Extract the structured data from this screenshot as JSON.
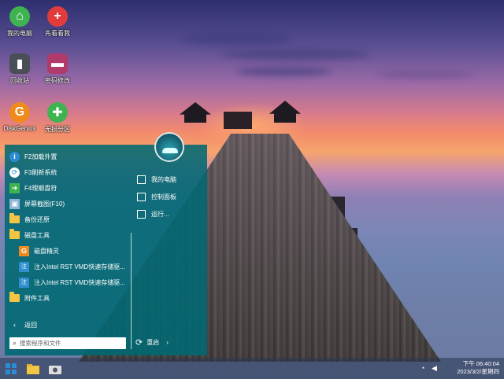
{
  "desktop": {
    "icons": [
      {
        "label": "我的电脑",
        "icon": "computer-icon",
        "color": "#3fb34f"
      },
      {
        "label": "先看看我",
        "icon": "plus-icon",
        "color": "#e23b3b"
      },
      {
        "label": "回收站",
        "icon": "recycle-bin-icon",
        "color": "#5a5f66"
      },
      {
        "label": "密码修改",
        "icon": "password-icon",
        "color": "#b03a6a"
      },
      {
        "label": "DiskGenius",
        "icon": "diskgenius-icon",
        "color": "#f08a1c"
      },
      {
        "label": "无损分区",
        "icon": "partition-icon",
        "color": "#3fb34f"
      }
    ]
  },
  "start_menu": {
    "left_items": [
      {
        "label": "F2加载外置",
        "icon": "info-icon"
      },
      {
        "label": "F3刷新系统",
        "icon": "refresh-icon"
      },
      {
        "label": "F4理顺盘符",
        "icon": "arrow-icon"
      },
      {
        "label": "屏幕截图(F10)",
        "icon": "screenshot-icon"
      },
      {
        "label": "备份还原",
        "icon": "folder-icon"
      },
      {
        "label": "磁盘工具",
        "icon": "folder-icon"
      },
      {
        "label": "磁盘精灵",
        "icon": "diskgenius-icon"
      },
      {
        "label": "注入Intel RST VMD快速存储驱...",
        "icon": "driver-icon"
      },
      {
        "label": "注入Intel RST VMD快速存储驱...",
        "icon": "driver-icon"
      },
      {
        "label": "附件工具",
        "icon": "folder-icon"
      }
    ],
    "back_label": "返回",
    "right_items": [
      {
        "label": "我的电脑",
        "icon": "computer-icon"
      },
      {
        "label": "控制面板",
        "icon": "control-panel-icon"
      },
      {
        "label": "运行...",
        "icon": "run-icon"
      }
    ],
    "search_placeholder": "搜索程序和文件",
    "restart_label": "重启"
  },
  "taskbar": {
    "time": "下午 06:40:04",
    "date": "2023/3/2/星期四",
    "accent": "#2a8cd6"
  }
}
